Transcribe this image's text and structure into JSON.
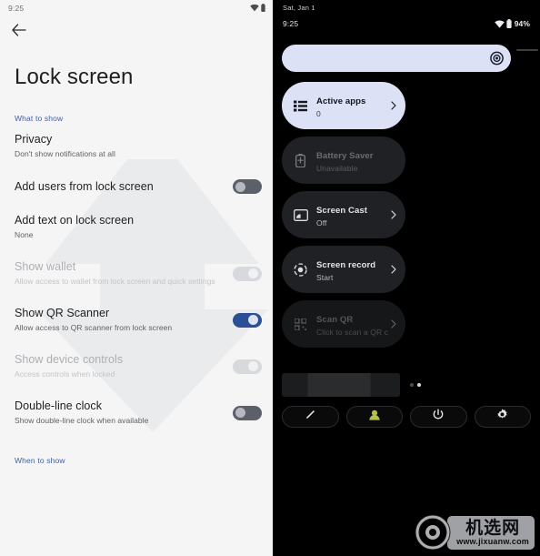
{
  "left_panel": {
    "statusbar": {
      "time": "9:25",
      "wifi_icon": "wifi-icon",
      "battery_icon": "battery-icon"
    },
    "back_icon": "back-arrow-icon",
    "title": "Lock screen",
    "section_label": "What to show",
    "section_label_bottom": "When to show",
    "rows": [
      {
        "title": "Privacy",
        "subtitle": "Don't show notifications at all",
        "control": "none",
        "state": ""
      },
      {
        "title": "Add users from lock screen",
        "subtitle": "",
        "control": "toggle",
        "state": "off"
      },
      {
        "title": "Add text on lock screen",
        "subtitle": "None",
        "control": "none",
        "state": ""
      },
      {
        "title": "Show wallet",
        "subtitle": "Allow access to wallet from lock screen and quick settings",
        "control": "toggle",
        "state": "disabled"
      },
      {
        "title": "Show QR Scanner",
        "subtitle": "Allow access to QR scanner from lock screen",
        "control": "toggle",
        "state": "on"
      },
      {
        "title": "Show device controls",
        "subtitle": "Access controls when locked",
        "control": "toggle",
        "state": "disabled"
      },
      {
        "title": "Double-line clock",
        "subtitle": "Show double-line clock when available",
        "control": "toggle",
        "state": "off"
      }
    ]
  },
  "right_panel": {
    "date": "Sat, Jan 1",
    "statusbar": {
      "time": "9:25",
      "wifi_icon": "wifi-icon",
      "battery_icon": "battery-icon",
      "battery_percent": "94%"
    },
    "brightness": {
      "name": "brightness-slider",
      "thumb_icon": "brightness-icon",
      "value_percent": 92
    },
    "tiles": [
      {
        "label": "Active apps",
        "sub": "0",
        "icon": "list-icon",
        "style": "light",
        "chevron": true
      },
      {
        "label": "Battery Saver",
        "sub": "Unavailable",
        "icon": "battery-saver-icon",
        "style": "dark muted",
        "chevron": false
      },
      {
        "label": "Screen Cast",
        "sub": "Off",
        "icon": "cast-icon",
        "style": "dark",
        "chevron": true
      },
      {
        "label": "Screen record",
        "sub": "Start",
        "icon": "record-icon",
        "style": "dark",
        "chevron": true
      },
      {
        "label": "Scan QR",
        "sub": "Click to scan a QR c",
        "icon": "qr-icon",
        "style": "ghost",
        "chevron": true
      }
    ],
    "pager": {
      "dots": 2,
      "active_index": 1
    },
    "bottom_buttons": [
      {
        "icon": "pencil-edit-icon",
        "name": "edit-tiles-button"
      },
      {
        "icon": "user-avatar-icon",
        "name": "user-switch-button"
      },
      {
        "icon": "power-icon",
        "name": "power-button"
      },
      {
        "icon": "gear-icon",
        "name": "settings-button"
      }
    ]
  },
  "watermark": {
    "cn_text": "机选网",
    "url": "www.jixuanw.com"
  },
  "colors": {
    "accent_blue": "#2b4f94",
    "tile_light": "#dde1f5",
    "tile_dark": "#202124",
    "left_bg": "#f5f5f6",
    "right_bg": "#000000",
    "section_label": "#3f5f9e"
  }
}
